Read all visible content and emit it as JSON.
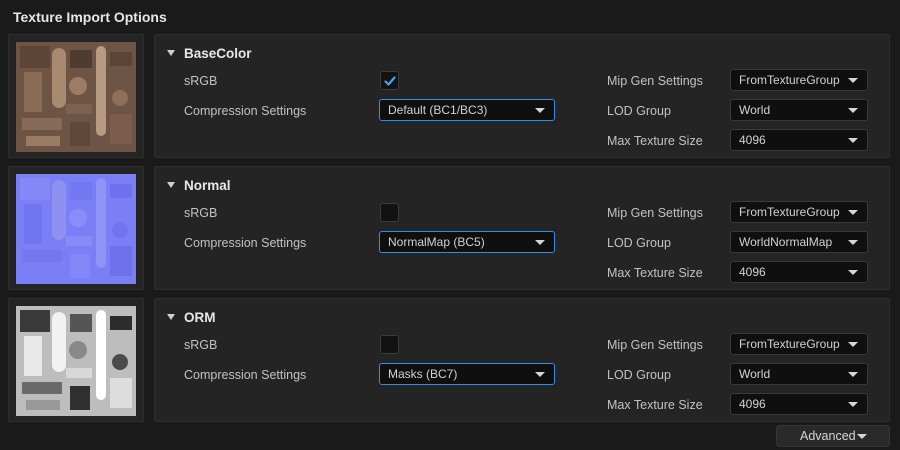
{
  "window": {
    "title": "Texture Import Options"
  },
  "labels": {
    "srgb": "sRGB",
    "compression": "Compression Settings",
    "mip_gen": "Mip Gen Settings",
    "lod_group": "LOD Group",
    "max_size": "Max Texture Size"
  },
  "groups": [
    {
      "name": "BaseColor",
      "srgb_checked": true,
      "compression": "Default (BC1/BC3)",
      "mip_gen": "FromTextureGroup",
      "lod_group": "World",
      "max_size": "4096",
      "thumbnail_color": "#6e5444"
    },
    {
      "name": "Normal",
      "srgb_checked": false,
      "compression": "NormalMap (BC5)",
      "mip_gen": "FromTextureGroup",
      "lod_group": "WorldNormalMap",
      "max_size": "4096",
      "thumbnail_color": "#7b7ff6"
    },
    {
      "name": "ORM",
      "srgb_checked": false,
      "compression": "Masks (BC7)",
      "mip_gen": "FromTextureGroup",
      "lod_group": "World",
      "max_size": "4096",
      "thumbnail_color": "#c8c8c8"
    }
  ],
  "footer": {
    "advanced_label": "Advanced"
  },
  "colors": {
    "focus_border": "#2f8fe6",
    "checkmark": "#4aa0f0",
    "panel_bg": "#242424"
  }
}
